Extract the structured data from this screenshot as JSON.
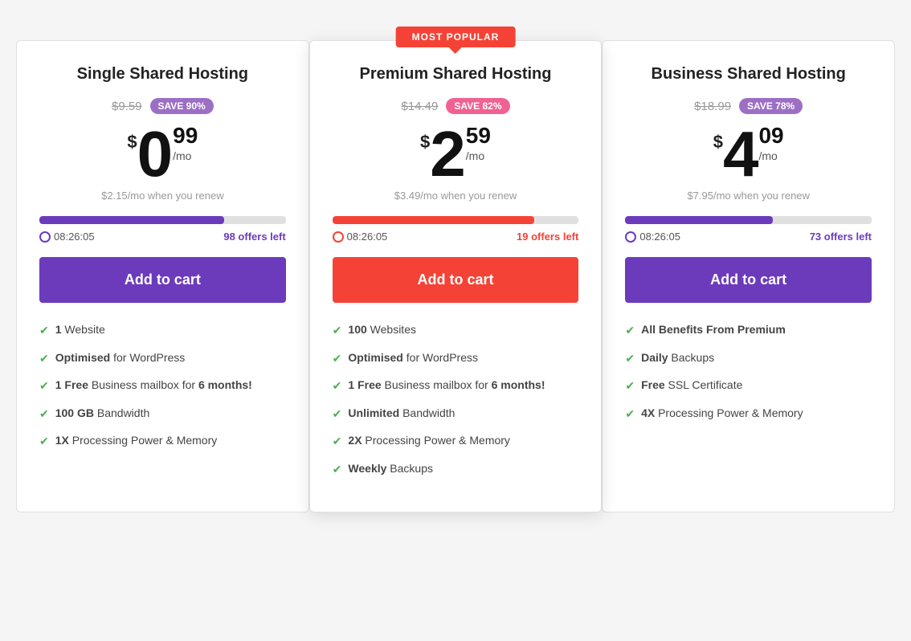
{
  "plans": [
    {
      "id": "single",
      "title": "Single Shared Hosting",
      "original_price": "$9.59",
      "save_label": "SAVE 90%",
      "save_badge_color": "purple",
      "price_main": "0",
      "price_cents": "99",
      "per_mo": "/mo",
      "renew_price": "$2.15/mo when you renew",
      "progress_percent": 75,
      "progress_color": "#6c3bbc",
      "timer": "08:26:05",
      "offers_count": "98",
      "offers_label": "offers left",
      "button_label": "Add to cart",
      "button_color": "purple",
      "features": [
        {
          "bold": "1",
          "text": " Website"
        },
        {
          "bold": "Optimised",
          "text": " for WordPress"
        },
        {
          "bold": "1 Free",
          "text": " Business mailbox for ",
          "bold2": "6 months!"
        },
        {
          "bold": "100 GB",
          "text": " Bandwidth"
        },
        {
          "bold": "1X",
          "text": " Processing Power & Memory"
        }
      ]
    },
    {
      "id": "premium",
      "title": "Premium Shared Hosting",
      "original_price": "$14.49",
      "save_label": "SAVE 82%",
      "save_badge_color": "pink",
      "price_main": "2",
      "price_cents": "59",
      "per_mo": "/mo",
      "renew_price": "$3.49/mo when you renew",
      "progress_percent": 82,
      "progress_color": "#f44336",
      "timer": "08:26:05",
      "offers_count": "19",
      "offers_label": "offers left",
      "button_label": "Add to cart",
      "button_color": "red",
      "is_popular": true,
      "popular_label": "MOST POPULAR",
      "features": [
        {
          "bold": "100",
          "text": " Websites"
        },
        {
          "bold": "Optimised",
          "text": " for WordPress"
        },
        {
          "bold": "1 Free",
          "text": " Business mailbox for ",
          "bold2": "6 months!"
        },
        {
          "bold": "Unlimited",
          "text": " Bandwidth"
        },
        {
          "bold": "2X",
          "text": " Processing Power & Memory"
        },
        {
          "bold": "Weekly",
          "text": " Backups",
          "link": true
        }
      ]
    },
    {
      "id": "business",
      "title": "Business Shared Hosting",
      "original_price": "$18.99",
      "save_label": "SAVE 78%",
      "save_badge_color": "purple",
      "price_main": "4",
      "price_cents": "09",
      "per_mo": "/mo",
      "renew_price": "$7.95/mo when you renew",
      "progress_percent": 60,
      "progress_color": "#6c3bbc",
      "timer": "08:26:05",
      "offers_count": "73",
      "offers_label": "offers left",
      "button_label": "Add to cart",
      "button_color": "purple",
      "features": [
        {
          "bold": "All Benefits From Premium",
          "text": ""
        },
        {
          "bold": "Daily",
          "text": " Backups"
        },
        {
          "bold": "Free",
          "text": " SSL Certificate"
        },
        {
          "bold": "4X",
          "text": " Processing Power & Memory"
        }
      ]
    }
  ]
}
